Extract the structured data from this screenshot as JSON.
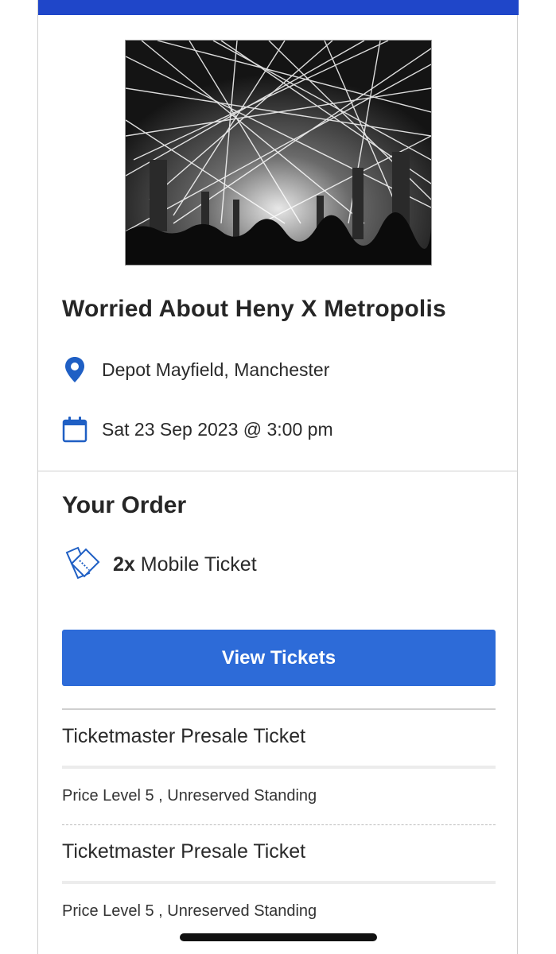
{
  "event": {
    "title": "Worried About Heny X Metropolis",
    "venue": "Depot Mayfield, Manchester",
    "datetime": "Sat 23 Sep 2023 @ 3:00 pm",
    "venue_icon": "map-pin-icon",
    "date_icon": "calendar-icon"
  },
  "order": {
    "title": "Your Order",
    "quantity": "2x",
    "ticket_type": "Mobile Ticket",
    "ticket_icon": "ticket-icon",
    "view_button": "View Tickets"
  },
  "tickets": [
    {
      "name": "Ticketmaster Presale Ticket",
      "detail": "Price Level 5 , Unreserved Standing"
    },
    {
      "name": "Ticketmaster Presale Ticket",
      "detail": "Price Level 5 , Unreserved Standing"
    }
  ],
  "colors": {
    "banner": "#1f46c9",
    "accent": "#2d6bd8",
    "icon": "#1f5fc4"
  }
}
